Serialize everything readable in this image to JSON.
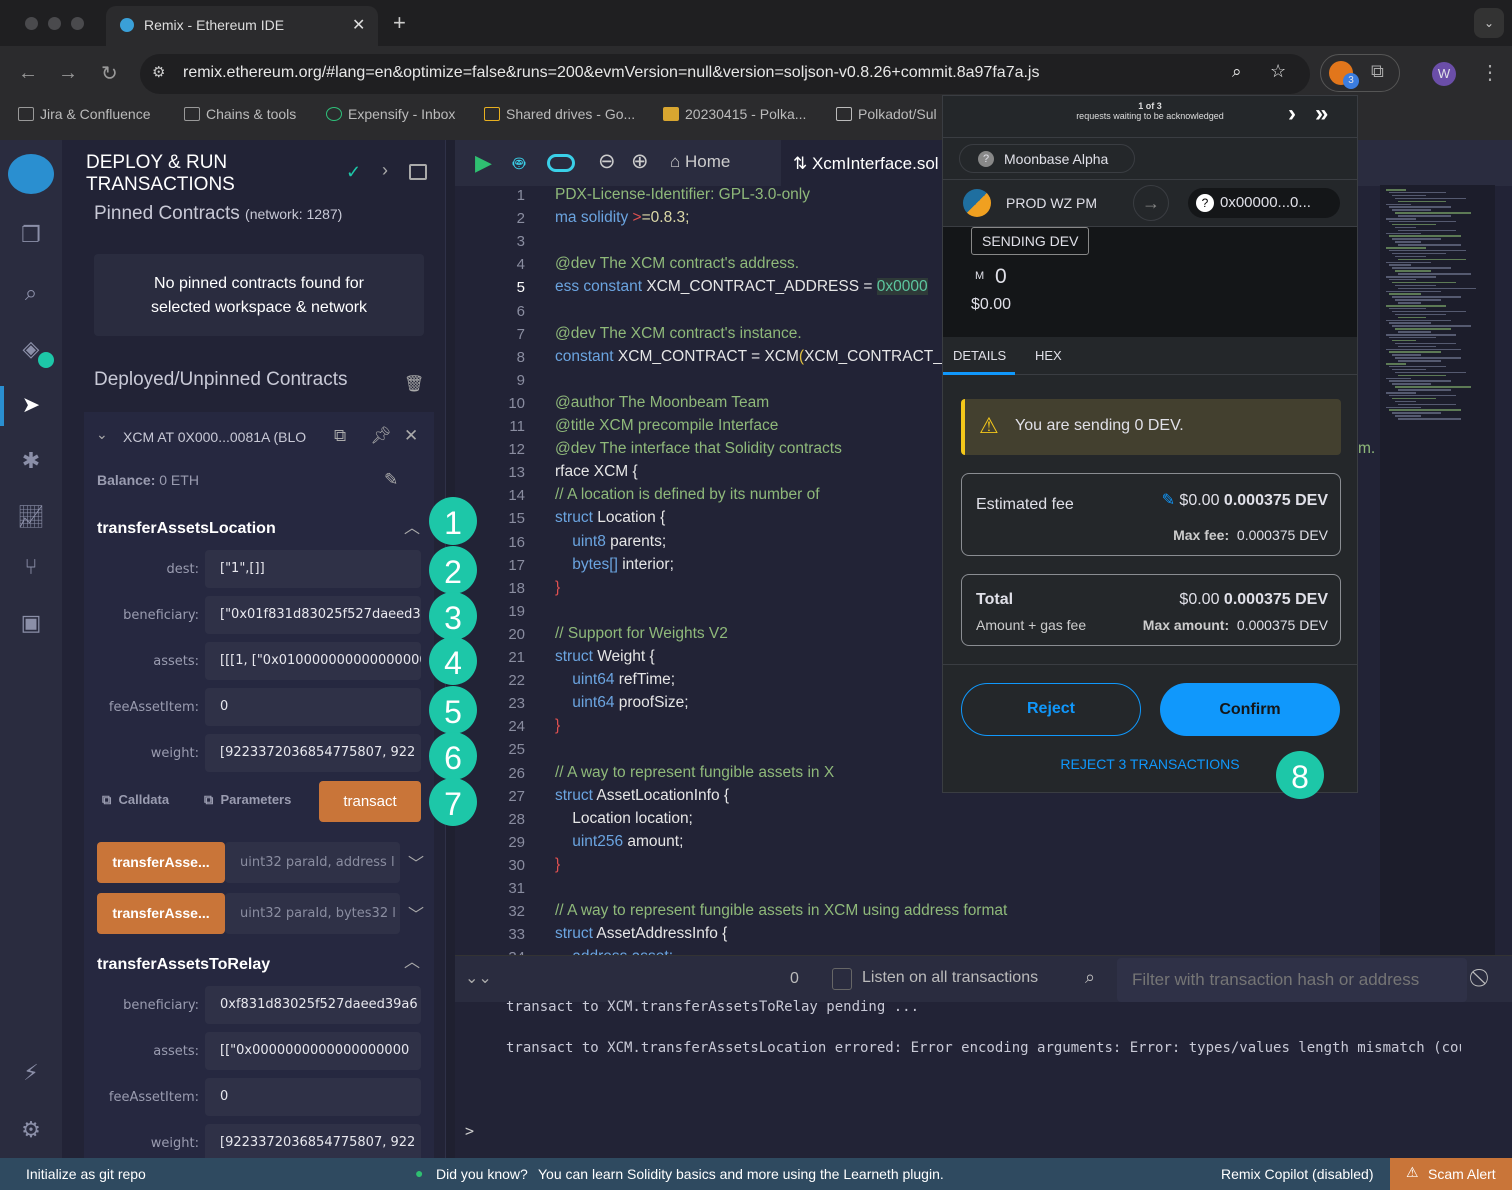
{
  "browser": {
    "tab_title": "Remix - Ethereum IDE",
    "url": "remix.ethereum.org/#lang=en&optimize=false&runs=200&evmVersion=null&version=soljson-v0.8.26+commit.8a97fa7a.js",
    "extension_badge": "3",
    "profile_initial": "W",
    "bookmarks": [
      "Jira & Confluence",
      "Chains & tools",
      "Expensify - Inbox",
      "Shared drives - Go...",
      "20230415 - Polka...",
      "Polkadot/Sul"
    ]
  },
  "panel": {
    "title": "DEPLOY & RUN TRANSACTIONS",
    "pinned_title": "Pinned Contracts",
    "pinned_network": "(network: 1287)",
    "no_pinned": "No pinned contracts found for selected workspace & network",
    "deployed_title": "Deployed/Unpinned Contracts",
    "contract_name": "XCM AT 0X000...0081A (BLO",
    "balance_label": "Balance:",
    "balance_value": "0 ETH",
    "fn1": {
      "name": "transferAssetsLocation",
      "fields": [
        {
          "label": "dest:",
          "value": "[\"1\",[]]"
        },
        {
          "label": "beneficiary:",
          "value": "[\"0x01f831d83025f527daeed3"
        },
        {
          "label": "assets:",
          "value": "[[[1, [\"0x0100000000000000000"
        },
        {
          "label": "feeAssetItem:",
          "value": "0"
        },
        {
          "label": "weight:",
          "value": "[9223372036854775807, 922"
        }
      ]
    },
    "calldata": "Calldata",
    "parameters": "Parameters",
    "transact": "transact",
    "collapsed": [
      {
        "name": "transferAsse...",
        "placeholder": "uint32 paraId, address l"
      },
      {
        "name": "transferAsse...",
        "placeholder": "uint32 paraId, bytes32 l"
      }
    ],
    "fn2": {
      "name": "transferAssetsToRelay",
      "fields": [
        {
          "label": "beneficiary:",
          "value": "0xf831d83025f527daeed39a6"
        },
        {
          "label": "assets:",
          "value": "[[\"0x0000000000000000000"
        },
        {
          "label": "feeAssetItem:",
          "value": "0"
        },
        {
          "label": "weight:",
          "value": "[9223372036854775807, 922"
        }
      ]
    }
  },
  "editor": {
    "home_tab": "Home",
    "file_tab": "XcmInterface.sol",
    "overflow_text": "m.",
    "lines": [
      [
        [
          "PDX-License-Identifier: GPL-3.0-only",
          "com"
        ]
      ],
      [
        [
          "ma solidity ",
          "kw"
        ],
        [
          ">",
          "op"
        ],
        [
          "=0.8.3;",
          "num"
        ]
      ],
      [],
      [
        [
          "@dev The XCM contract's address.",
          "com"
        ]
      ],
      [
        [
          "ess constant ",
          "kw"
        ],
        [
          "XCM_CONTRACT_ADDRESS = ",
          ""
        ],
        [
          "0x0000",
          "hex"
        ]
      ],
      [],
      [
        [
          "@dev The XCM contract's instance.",
          "com"
        ]
      ],
      [
        [
          "constant ",
          "kw"
        ],
        [
          "XCM_CONTRACT = XCM",
          ""
        ],
        [
          "(",
          "par"
        ],
        [
          "XCM_CONTRACT_A",
          ""
        ]
      ],
      [],
      [
        [
          "@author The Moonbeam Team",
          "com"
        ]
      ],
      [
        [
          "@title XCM precompile Interface",
          "com"
        ]
      ],
      [
        [
          "@dev The interface that Solidity contracts",
          "com"
        ]
      ],
      [
        [
          "rface XCM {",
          ""
        ]
      ],
      [
        [
          "// A location is defined by its number of",
          "com"
        ]
      ],
      [
        [
          "struct ",
          "kw"
        ],
        [
          "Location {",
          ""
        ]
      ],
      [
        [
          "    uint8 ",
          "kw"
        ],
        [
          "parents;",
          ""
        ]
      ],
      [
        [
          "    bytes[] ",
          "kw"
        ],
        [
          "interior;",
          ""
        ]
      ],
      [
        [
          "}",
          "op"
        ]
      ],
      [],
      [
        [
          "// Support for Weights V2",
          "com"
        ]
      ],
      [
        [
          "struct ",
          "kw"
        ],
        [
          "Weight {",
          ""
        ]
      ],
      [
        [
          "    uint64 ",
          "kw"
        ],
        [
          "refTime;",
          ""
        ]
      ],
      [
        [
          "    uint64 ",
          "kw"
        ],
        [
          "proofSize;",
          ""
        ]
      ],
      [
        [
          "}",
          "op"
        ]
      ],
      [],
      [
        [
          "// A way to represent fungible assets in X",
          "com"
        ]
      ],
      [
        [
          "struct ",
          "kw"
        ],
        [
          "AssetLocationInfo {",
          ""
        ]
      ],
      [
        [
          "    Location location;",
          ""
        ]
      ],
      [
        [
          "    uint256 ",
          "kw"
        ],
        [
          "amount;",
          ""
        ]
      ],
      [
        [
          "}",
          "op"
        ]
      ],
      [],
      [
        [
          "// A way to represent fungible assets in XCM using address format",
          "com"
        ]
      ],
      [
        [
          "struct ",
          "kw"
        ],
        [
          "AssetAddressInfo {",
          ""
        ]
      ],
      [
        [
          "    address asset;",
          "kw"
        ]
      ]
    ]
  },
  "terminal": {
    "count": "0",
    "listen_label": "Listen on all transactions",
    "filter_placeholder": "Filter with transaction hash or address",
    "logs": [
      "transact to XCM.transferAssetsToRelay pending ...",
      "transact to XCM.transferAssetsLocation errored: Error encoding arguments: Error: types/values length mismatch (coun"
    ],
    "prompt": ">"
  },
  "status": {
    "git": "Initialize as git repo",
    "tip_q": "Did you know?",
    "tip": "You can learn Solidity basics and more using the Learneth plugin.",
    "copilot": "Remix Copilot (disabled)",
    "scam": "Scam Alert"
  },
  "metamask": {
    "counter": "1 of 3",
    "waiting": "requests waiting to be acknowledged",
    "network": "Moonbase Alpha",
    "account": "PROD WZ PM",
    "recipient": "0x00000...0...",
    "sending": "SENDING DEV",
    "amount_symbol": "M",
    "amount": "0",
    "amount_usd": "$0.00",
    "tabs": [
      "DETAILS",
      "HEX"
    ],
    "warning": "You are sending 0 DEV.",
    "fee_label": "Estimated fee",
    "fee_usd": "$0.00",
    "fee": "0.000375 DEV",
    "max_fee_label": "Max fee:",
    "max_fee": "0.000375 DEV",
    "total_label": "Total",
    "total_sub": "Amount + gas fee",
    "total_usd": "$0.00",
    "total": "0.000375 DEV",
    "max_amount_label": "Max amount:",
    "max_amount": "0.000375 DEV",
    "reject": "Reject",
    "confirm": "Confirm",
    "reject_all": "REJECT 3 TRANSACTIONS",
    "accent": "#1098fc"
  },
  "annotations": [
    "1",
    "2",
    "3",
    "4",
    "5",
    "6",
    "7",
    "8"
  ],
  "colors": {
    "badge": "#1dc7a8",
    "orange": "#c97539",
    "status": "#2f4a60"
  }
}
